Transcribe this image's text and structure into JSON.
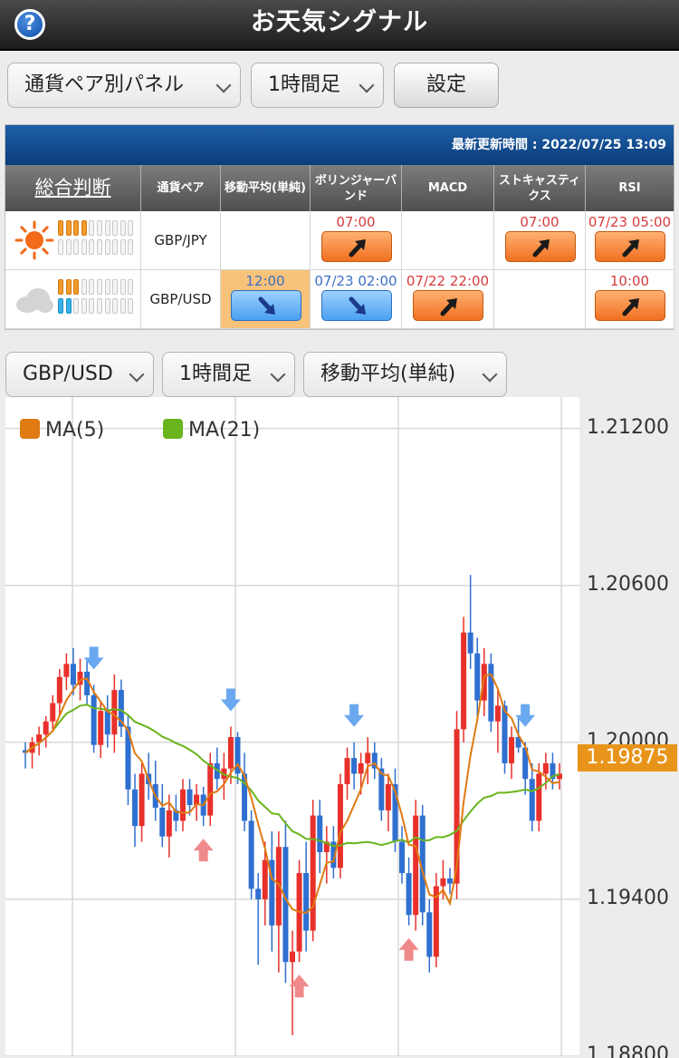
{
  "header": {
    "title": "お天気シグナル",
    "help_icon_text": "?"
  },
  "controls": {
    "panel_select": "通貨ペア別パネル",
    "timeframe_select": "1時間足",
    "settings_button": "設定"
  },
  "panel": {
    "updated": "最新更新時間 : 2022/07/25 13:09",
    "columns": [
      "総合判断",
      "通貨ペア",
      "移動平均(単純)",
      "ボリンジャーバンド",
      "MACD",
      "ストキャスティクス",
      "RSI"
    ],
    "rows": [
      {
        "pair": "GBP/JPY",
        "weather": "sun-icon",
        "signals": [
          {
            "time": "",
            "dir": "",
            "color": ""
          },
          {
            "time": "07:00",
            "dir": "up",
            "color": "red"
          },
          {
            "time": "",
            "dir": "",
            "color": ""
          },
          {
            "time": "07:00",
            "dir": "up",
            "color": "red"
          },
          {
            "time": "07/23 05:00",
            "dir": "up",
            "color": "red"
          }
        ],
        "meter_top_lit": 4,
        "meter_top_color": "orange",
        "meter_bottom_lit": 0,
        "meter_bottom_color": "gray"
      },
      {
        "pair": "GBP/USD",
        "weather": "cloud-icon",
        "signals": [
          {
            "time": "12:00",
            "dir": "down",
            "color": "blue"
          },
          {
            "time": "07/23 02:00",
            "dir": "down",
            "color": "blue"
          },
          {
            "time": "07/22 22:00",
            "dir": "up",
            "color": "red"
          },
          {
            "time": "",
            "dir": "",
            "color": ""
          },
          {
            "time": "10:00",
            "dir": "up",
            "color": "red"
          }
        ],
        "meter_top_lit": 3,
        "meter_top_color": "orange",
        "meter_bottom_lit": 2,
        "meter_bottom_color": "blue"
      }
    ]
  },
  "chart_controls": {
    "pair_select": "GBP/USD",
    "timeframe_select": "1時間足",
    "indicator_select": "移動平均(単純)"
  },
  "chart_data": {
    "type": "candlestick",
    "legend": [
      "MA(5)",
      "MA(21)"
    ],
    "colors": {
      "up": "#e8302a",
      "down": "#2f6fd0",
      "ma5": "#e07a12",
      "ma21": "#6ab41e",
      "sig_up": "#f08a8a",
      "sig_down": "#6aa8f0"
    },
    "y_ticks": [
      "1.21200",
      "1.20600",
      "1.20000",
      "1.19400",
      "1.18800"
    ],
    "ylim": [
      1.188,
      1.2132
    ],
    "last_price": "1.19875",
    "candles": [
      [
        1.1997,
        1.2,
        1.199,
        1.1996
      ],
      [
        1.1996,
        1.2002,
        1.199,
        1.2
      ],
      [
        1.2,
        1.2006,
        1.1995,
        1.2003
      ],
      [
        1.2003,
        1.201,
        1.1998,
        1.2008
      ],
      [
        1.2008,
        1.2018,
        1.2005,
        1.2015
      ],
      [
        1.2015,
        1.2028,
        1.201,
        1.2025
      ],
      [
        1.2025,
        1.2034,
        1.202,
        1.203
      ],
      [
        1.203,
        1.2036,
        1.2018,
        1.2022
      ],
      [
        1.2022,
        1.2032,
        1.2016,
        1.2027
      ],
      [
        1.2027,
        1.2032,
        1.2014,
        1.2018
      ],
      [
        1.2018,
        1.2022,
        1.1996,
        1.1999
      ],
      [
        1.1999,
        1.2016,
        1.1994,
        1.2012
      ],
      [
        1.2012,
        1.2018,
        1.1998,
        1.2003
      ],
      [
        1.2003,
        1.2026,
        1.1996,
        1.202
      ],
      [
        1.202,
        1.2024,
        1.2002,
        1.2006
      ],
      [
        1.2006,
        1.201,
        1.1976,
        1.1982
      ],
      [
        1.1982,
        1.1988,
        1.196,
        1.1968
      ],
      [
        1.1968,
        1.1992,
        1.1962,
        1.1988
      ],
      [
        1.1988,
        1.1996,
        1.1978,
        1.1984
      ],
      [
        1.1984,
        1.1993,
        1.197,
        1.1975
      ],
      [
        1.1975,
        1.1984,
        1.196,
        1.1964
      ],
      [
        1.1964,
        1.198,
        1.1956,
        1.1974
      ],
      [
        1.1974,
        1.198,
        1.1966,
        1.197
      ],
      [
        1.197,
        1.1986,
        1.1966,
        1.1982
      ],
      [
        1.1982,
        1.1986,
        1.1972,
        1.1976
      ],
      [
        1.1976,
        1.1984,
        1.197,
        1.198
      ],
      [
        1.198,
        1.1983,
        1.1968,
        1.1972
      ],
      [
        1.1972,
        1.1996,
        1.1968,
        1.1992
      ],
      [
        1.1992,
        1.1998,
        1.1982,
        1.1986
      ],
      [
        1.1986,
        1.1996,
        1.1978,
        1.199
      ],
      [
        1.199,
        1.2006,
        1.1984,
        1.2002
      ],
      [
        1.2002,
        1.2004,
        1.1984,
        1.1988
      ],
      [
        1.1988,
        1.1996,
        1.1966,
        1.197
      ],
      [
        1.197,
        1.1974,
        1.194,
        1.1944
      ],
      [
        1.1944,
        1.195,
        1.1915,
        1.194
      ],
      [
        1.194,
        1.1962,
        1.193,
        1.1955
      ],
      [
        1.1955,
        1.1966,
        1.192,
        1.193
      ],
      [
        1.193,
        1.1966,
        1.1912,
        1.196
      ],
      [
        1.196,
        1.197,
        1.1908,
        1.1916
      ],
      [
        1.1916,
        1.1928,
        1.1888,
        1.192
      ],
      [
        1.192,
        1.1955,
        1.1916,
        1.195
      ],
      [
        1.195,
        1.1962,
        1.192,
        1.1928
      ],
      [
        1.1928,
        1.1978,
        1.1924,
        1.1972
      ],
      [
        1.1972,
        1.1978,
        1.195,
        1.1958
      ],
      [
        1.1958,
        1.1968,
        1.1946,
        1.1962
      ],
      [
        1.1962,
        1.1968,
        1.1948,
        1.1952
      ],
      [
        1.1952,
        1.1988,
        1.1948,
        1.1984
      ],
      [
        1.1984,
        1.1998,
        1.1978,
        1.1994
      ],
      [
        1.1994,
        1.2,
        1.1982,
        1.1988
      ],
      [
        1.1988,
        1.1996,
        1.198,
        1.1992
      ],
      [
        1.1992,
        1.2002,
        1.1984,
        1.1996
      ],
      [
        1.1996,
        1.2,
        1.1986,
        1.199
      ],
      [
        1.199,
        1.1994,
        1.197,
        1.1974
      ],
      [
        1.1974,
        1.1988,
        1.1966,
        1.1984
      ],
      [
        1.1984,
        1.199,
        1.1958,
        1.1962
      ],
      [
        1.1962,
        1.1968,
        1.1946,
        1.195
      ],
      [
        1.195,
        1.1956,
        1.193,
        1.1934
      ],
      [
        1.1934,
        1.1978,
        1.1928,
        1.1972
      ],
      [
        1.1972,
        1.1976,
        1.193,
        1.1935
      ],
      [
        1.1935,
        1.194,
        1.1912,
        1.1918
      ],
      [
        1.1918,
        1.195,
        1.1914,
        1.1945
      ],
      [
        1.1945,
        1.1955,
        1.194,
        1.1948
      ],
      [
        1.1948,
        1.1952,
        1.1942,
        1.1946
      ],
      [
        1.1946,
        1.2012,
        1.194,
        1.2005
      ],
      [
        1.2005,
        1.2048,
        1.2,
        1.2042
      ],
      [
        1.2042,
        1.2064,
        1.2028,
        1.2034
      ],
      [
        1.2034,
        1.204,
        1.201,
        1.2016
      ],
      [
        1.2016,
        1.2036,
        1.201,
        1.203
      ],
      [
        1.203,
        1.2034,
        1.2004,
        1.2008
      ],
      [
        1.2008,
        1.202,
        1.1996,
        1.2014
      ],
      [
        1.2014,
        1.2016,
        1.1988,
        1.1992
      ],
      [
        1.1992,
        1.2006,
        1.1986,
        1.2002
      ],
      [
        1.2002,
        1.201,
        1.1996,
        1.1998
      ],
      [
        1.1998,
        1.2,
        1.198,
        1.1986
      ],
      [
        1.1986,
        1.1992,
        1.1966,
        1.197
      ],
      [
        1.197,
        1.1992,
        1.1966,
        1.1988
      ],
      [
        1.1988,
        1.1996,
        1.1982,
        1.1992
      ],
      [
        1.1992,
        1.1996,
        1.1982,
        1.1986
      ],
      [
        1.1986,
        1.1992,
        1.1982,
        1.1988
      ]
    ],
    "signals": [
      {
        "index": 10,
        "dir": "down"
      },
      {
        "index": 26,
        "dir": "up"
      },
      {
        "index": 30,
        "dir": "down"
      },
      {
        "index": 40,
        "dir": "up"
      },
      {
        "index": 48,
        "dir": "down"
      },
      {
        "index": 56,
        "dir": "up"
      },
      {
        "index": 73,
        "dir": "down"
      }
    ]
  }
}
